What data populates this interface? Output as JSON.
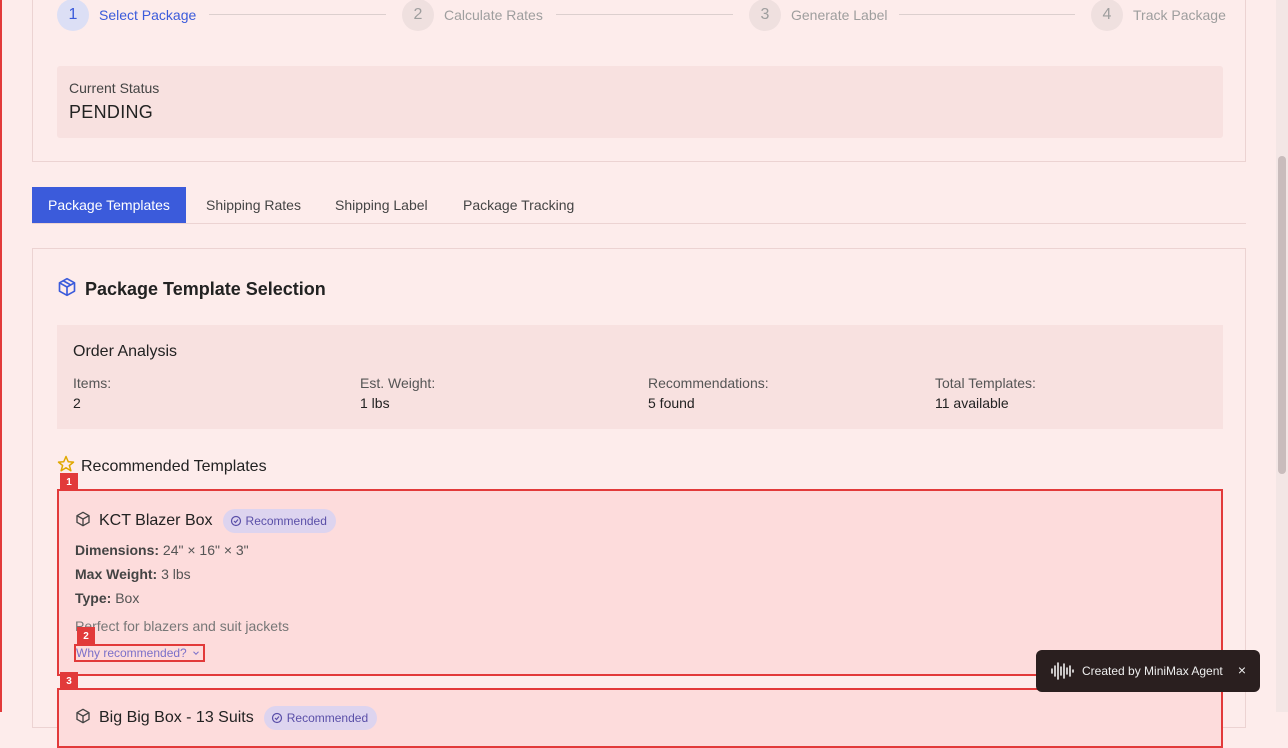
{
  "stepper": {
    "steps": [
      {
        "num": "1",
        "label": "Select Package"
      },
      {
        "num": "2",
        "label": "Calculate Rates"
      },
      {
        "num": "3",
        "label": "Generate Label"
      },
      {
        "num": "4",
        "label": "Track Package"
      }
    ],
    "active_step": 1
  },
  "status": {
    "label": "Current Status",
    "value": "PENDING"
  },
  "tabs": [
    "Package Templates",
    "Shipping Rates",
    "Shipping Label",
    "Package Tracking"
  ],
  "active_tab": "Package Templates",
  "section": {
    "title": "Package Template Selection",
    "icon": "package-icon"
  },
  "analysis": {
    "title": "Order Analysis",
    "items": [
      {
        "label": "Items:",
        "value": "2"
      },
      {
        "label": "Est. Weight:",
        "value": "1 lbs"
      },
      {
        "label": "Recommendations:",
        "value": "5 found"
      },
      {
        "label": "Total Templates:",
        "value": "11 available"
      }
    ]
  },
  "recommended": {
    "title": "Recommended Templates",
    "icon": "star-icon"
  },
  "templates": [
    {
      "name": "KCT Blazer Box",
      "badge": "Recommended",
      "dimensions_label": "Dimensions:",
      "dimensions": "24\" × 16\" × 3\"",
      "max_weight_label": "Max Weight:",
      "max_weight": "3 lbs",
      "type_label": "Type:",
      "type": "Box",
      "description": "Perfect for blazers and suit jackets",
      "why_link": "Why recommended?"
    },
    {
      "name": "Big Big Box - 13 Suits",
      "badge": "Recommended"
    }
  ],
  "markers": [
    "1",
    "2",
    "3"
  ],
  "toast": {
    "text": "Created by MiniMax Agent",
    "close": "×"
  },
  "colors": {
    "accent": "#3b5bdb",
    "highlight": "#e23a3a",
    "background": "#fdeceb"
  }
}
